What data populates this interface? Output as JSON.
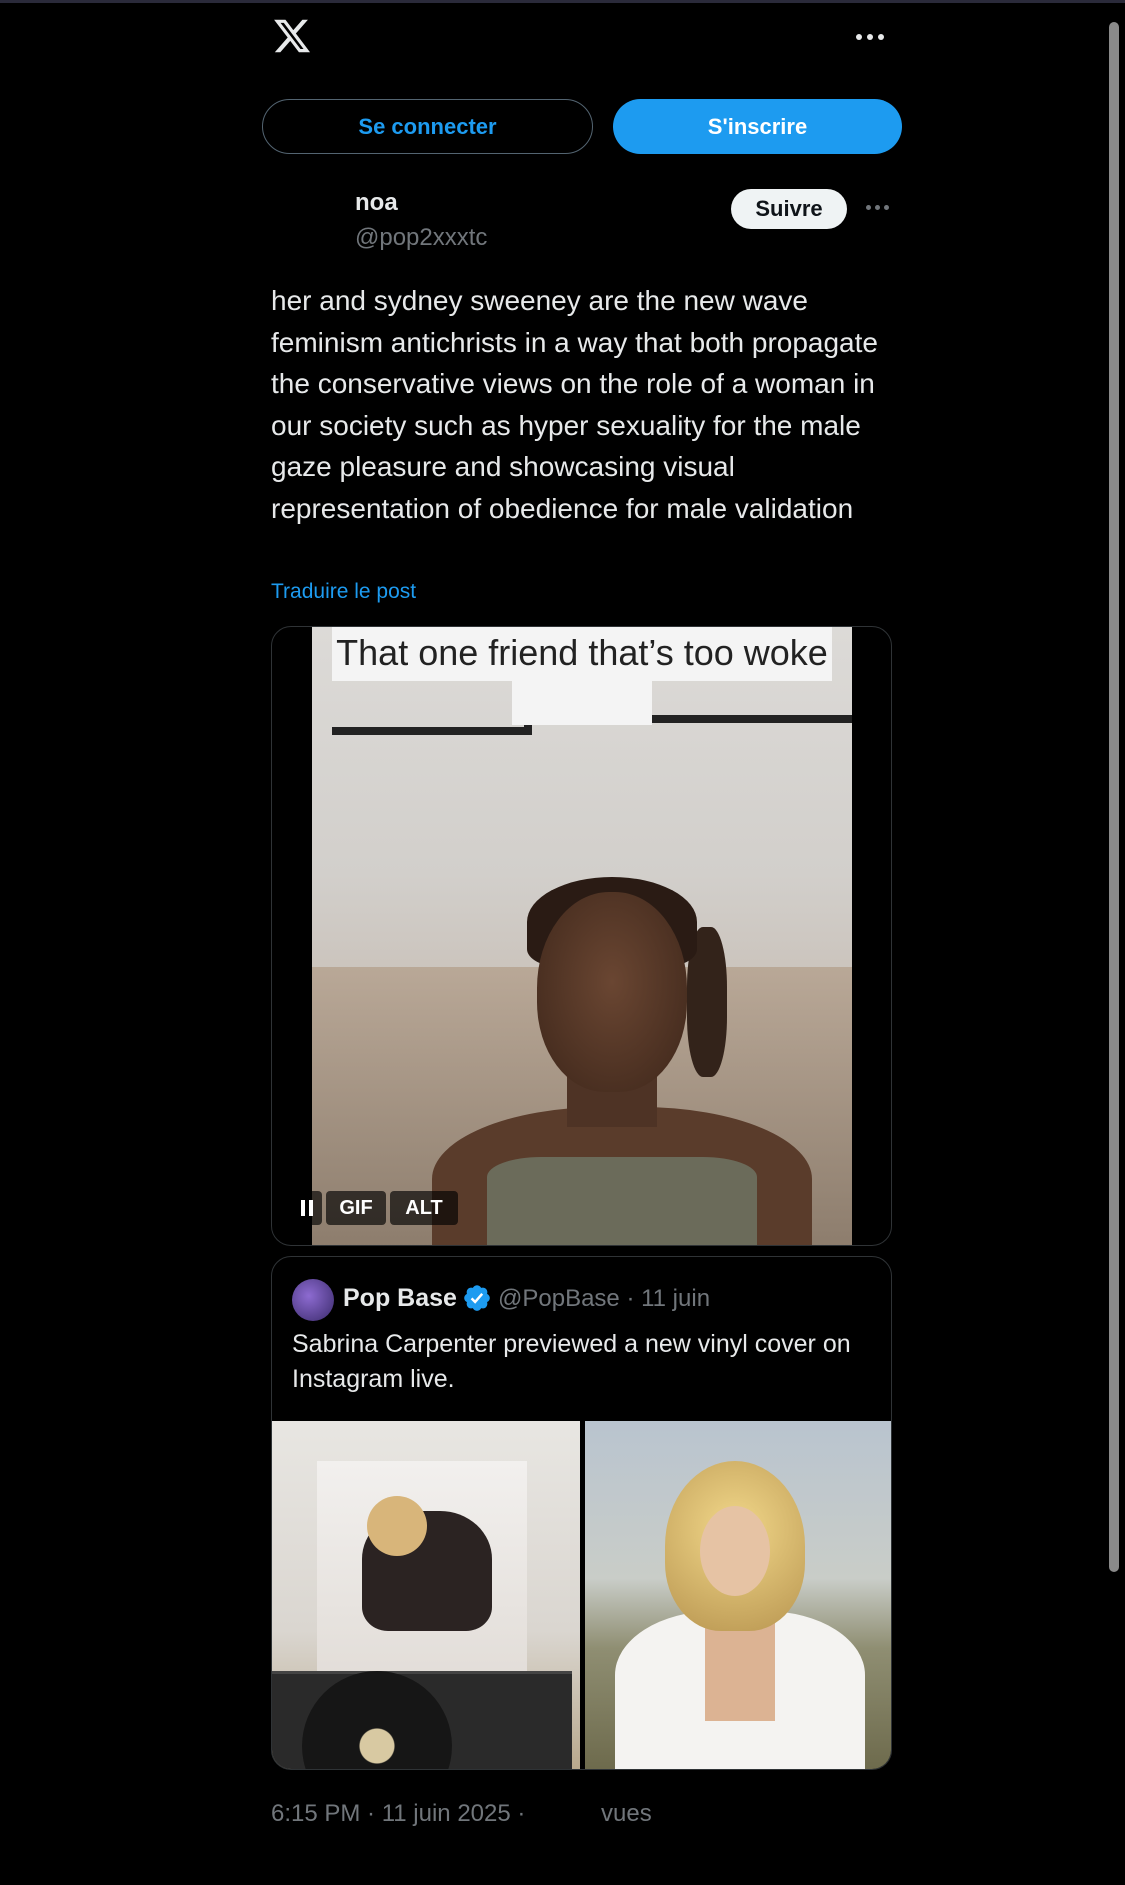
{
  "header": {
    "logo_icon": "x-logo-icon",
    "more_icon": "more-icon"
  },
  "auth": {
    "login_label": "Se connecter",
    "signup_label": "S'inscrire",
    "login_color": "#1d9bf0",
    "signup_bg": "#1d9bf0"
  },
  "post": {
    "author_name": "noa",
    "author_handle": "@pop2xxxtc",
    "follow_label": "Suivre",
    "text": "her and sydney sweeney are the new wave feminism antichrists in a way that both propagate the conservative views on the role of a woman in our society such as hyper sexuality for the male gaze pleasure and showcasing visual representation of obedience for male validation",
    "translate_label": "Traduire le post",
    "media": {
      "caption": "That one friend that’s too woke",
      "controls": {
        "gif_label": "GIF",
        "alt_label": "ALT"
      }
    },
    "timestamp": "6:15 PM · 11 juin 2025 ·",
    "views_label": "vues"
  },
  "quote": {
    "name": "Pop Base",
    "verified_icon": "verified-badge-icon",
    "handle_date": "@PopBase · 11 juin",
    "text": "Sabrina Carpenter previewed a new vinyl cover on Instagram live."
  }
}
